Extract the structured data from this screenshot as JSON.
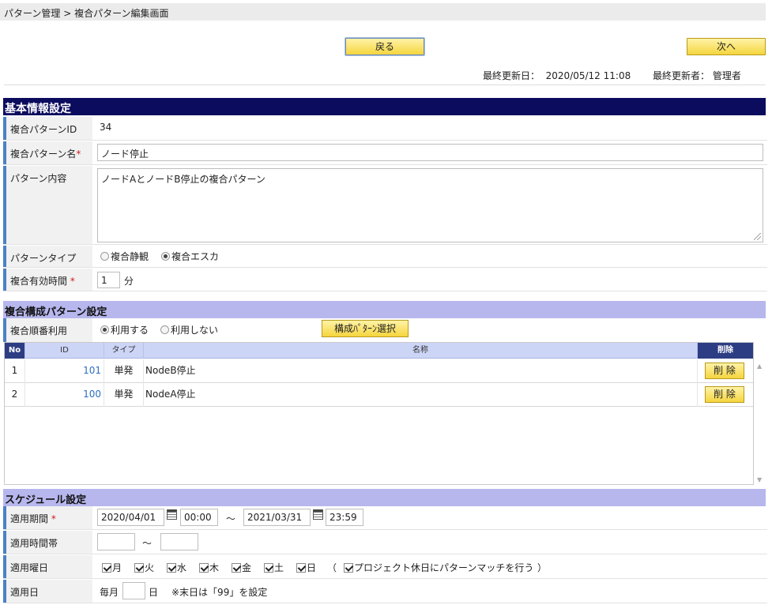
{
  "breadcrumb": "パターン管理 > 複合パターン編集画面",
  "buttons": {
    "back": "戻る",
    "next": "次へ"
  },
  "meta": {
    "updated_label": "最終更新日：",
    "updated_value": "2020/05/12 11:08",
    "updater_label": "最終更新者：",
    "updater_value": "管理者"
  },
  "basic": {
    "section_title": "基本情報設定",
    "id_label": "複合パターンID",
    "id_value": "34",
    "name_label": "複合パターン名",
    "required_mark": "*",
    "name_value": "ノード停止",
    "content_label": "パターン内容",
    "content_value": "ノードAとノードB停止の複合パターン",
    "type_label": "パターンタイプ",
    "type_options": [
      "複合静観",
      "複合エスカ"
    ],
    "type_selected": "複合エスカ",
    "valid_label": "複合有効時間",
    "valid_value": "1",
    "valid_unit": "分"
  },
  "composite": {
    "section_title": "複合構成パターン設定",
    "order_label": "複合順番利用",
    "order_options": [
      "利用する",
      "利用しない"
    ],
    "order_selected": "利用する",
    "select_button": "構成ﾊﾟﾀｰﾝ選択",
    "headers": {
      "no": "No",
      "id": "ID",
      "type": "タイプ",
      "name": "名称",
      "del": "削除"
    },
    "rows": [
      {
        "no": "1",
        "id": "101",
        "type": "単発",
        "name": "NodeB停止",
        "del": "削 除"
      },
      {
        "no": "2",
        "id": "100",
        "type": "単発",
        "name": "NodeA停止",
        "del": "削 除"
      }
    ]
  },
  "schedule": {
    "section_title": "スケジュール設定",
    "period_label": "適用期間",
    "start_date": "2020/04/01",
    "start_time": "00:00",
    "tilde": "～",
    "end_date": "2021/03/31",
    "end_time": "23:59",
    "hours_label": "適用時間帯",
    "hours_from": "",
    "hours_to": "",
    "weekday_label": "適用曜日",
    "weekdays": [
      "月",
      "火",
      "水",
      "木",
      "金",
      "土",
      "日"
    ],
    "open_paren": "（",
    "holiday_label": "プロジェクト休日にパターンマッチを行う",
    "close_paren": "）",
    "day_label": "適用日",
    "day_prefix": "毎月",
    "day_value": "",
    "day_unit": "日",
    "day_note": "※末日は「99」を設定"
  }
}
